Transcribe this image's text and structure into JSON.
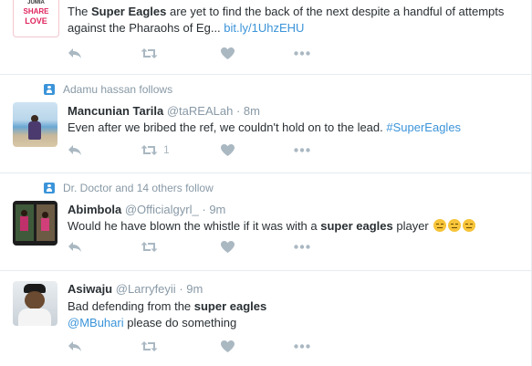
{
  "tweets": [
    {
      "text_parts": [
        "The ",
        "Super Eagles",
        " are yet to find the back of the next despite a handful of attempts against the Pharaohs of Eg... "
      ],
      "link": "bit.ly/1UhzEHU",
      "avatar": {
        "brand": "JUMIA",
        "line1": "SHARE",
        "line2": "LOVE"
      },
      "retweet_count": "",
      "like_count": ""
    },
    {
      "context": "Adamu hassan follows",
      "fullname": "Mancunian Tarila",
      "username": "@taREALah",
      "time": "8m",
      "text": "Even after we bribed the ref, we couldn't hold on to the lead. ",
      "hashtag": "#SuperEagles",
      "retweet_count": "1",
      "like_count": ""
    },
    {
      "context": "Dr. Doctor and 14 others follow",
      "fullname": "Abimbola",
      "username": "@Officialgyrl_",
      "time": "9m",
      "text_parts": [
        "Would he have blown the whistle if it was with a ",
        "super eagles",
        " player "
      ],
      "emoji_icon": "unamused-face-icon",
      "retweet_count": "",
      "like_count": ""
    },
    {
      "fullname": "Asiwaju",
      "username": "@Larryfeyii",
      "time": "9m",
      "text_parts": [
        "Bad defending from the ",
        "super eagles"
      ],
      "mention": "@MBuhari",
      "text_after_mention": " please do something",
      "retweet_count": "",
      "like_count": ""
    }
  ],
  "icons": [
    "reply-icon",
    "retweet-icon",
    "like-icon",
    "more-icon",
    "follows-icon"
  ],
  "colors": {
    "link": "#3b94d9",
    "meta": "#8899a6",
    "action": "#aab8c2",
    "divider": "#e6ecf0"
  }
}
